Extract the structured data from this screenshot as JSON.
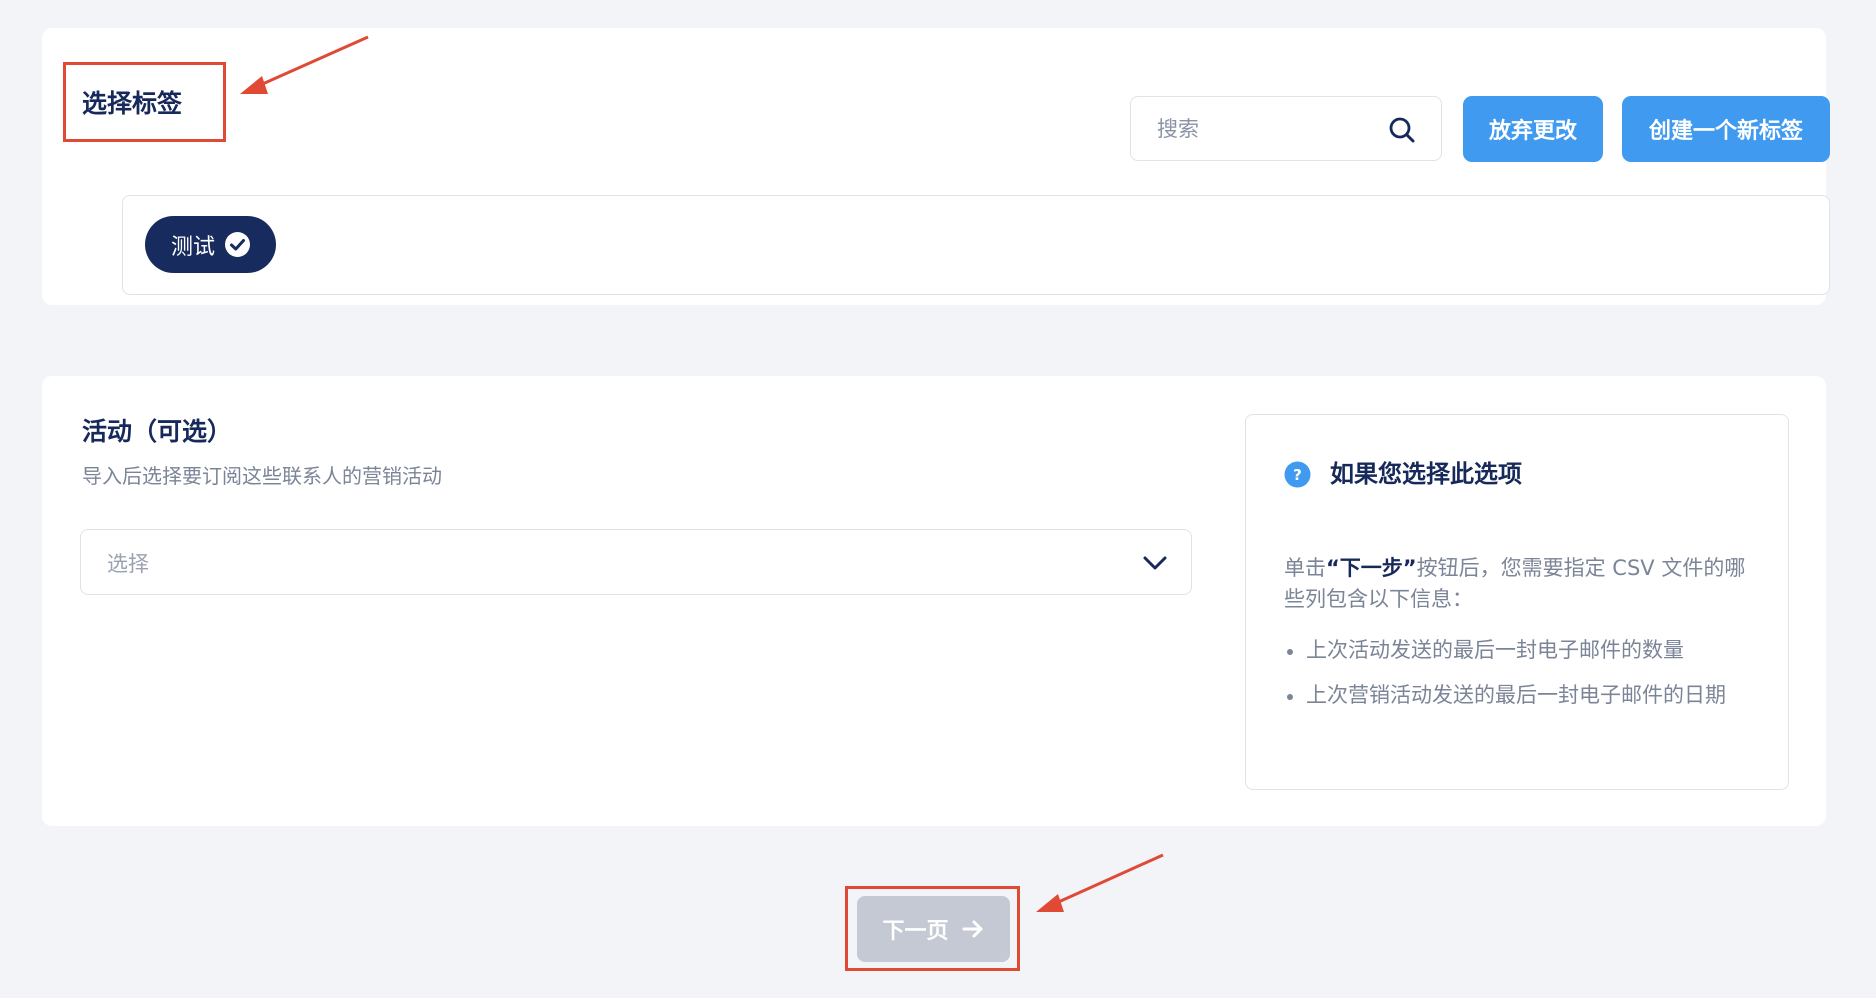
{
  "tags_section": {
    "title": "选择标签",
    "search_placeholder": "搜索",
    "discard_label": "放弃更改",
    "create_label": "创建一个新标签",
    "tags": [
      {
        "label": "测试",
        "selected": true
      }
    ]
  },
  "campaign_section": {
    "title": "活动（可选）",
    "subtitle": "导入后选择要订阅这些联系人的营销活动",
    "select_placeholder": "选择",
    "info": {
      "title": "如果您选择此选项",
      "desc_prefix": "单击",
      "desc_bold": "“下一步”",
      "desc_suffix": "按钮后，您需要指定 CSV 文件的哪些列包含以下信息：",
      "items": [
        "上次活动发送的最后一封电子邮件的数量",
        "上次营销活动发送的最后一封电子邮件的日期"
      ]
    }
  },
  "footer": {
    "next_label": "下一页"
  },
  "colors": {
    "primary_button": "#3f9af0",
    "tag_chip": "#172b5e",
    "title_text": "#16295a",
    "muted_text": "#7b8597",
    "disabled_button": "#c4c9d3",
    "annotation": "#e04a35",
    "background": "#f3f4f7"
  },
  "icons": {
    "search": "search-icon",
    "check": "check-circle-icon",
    "chevron": "chevron-down-icon",
    "help": "question-circle-icon",
    "arrow": "arrow-right-icon"
  }
}
